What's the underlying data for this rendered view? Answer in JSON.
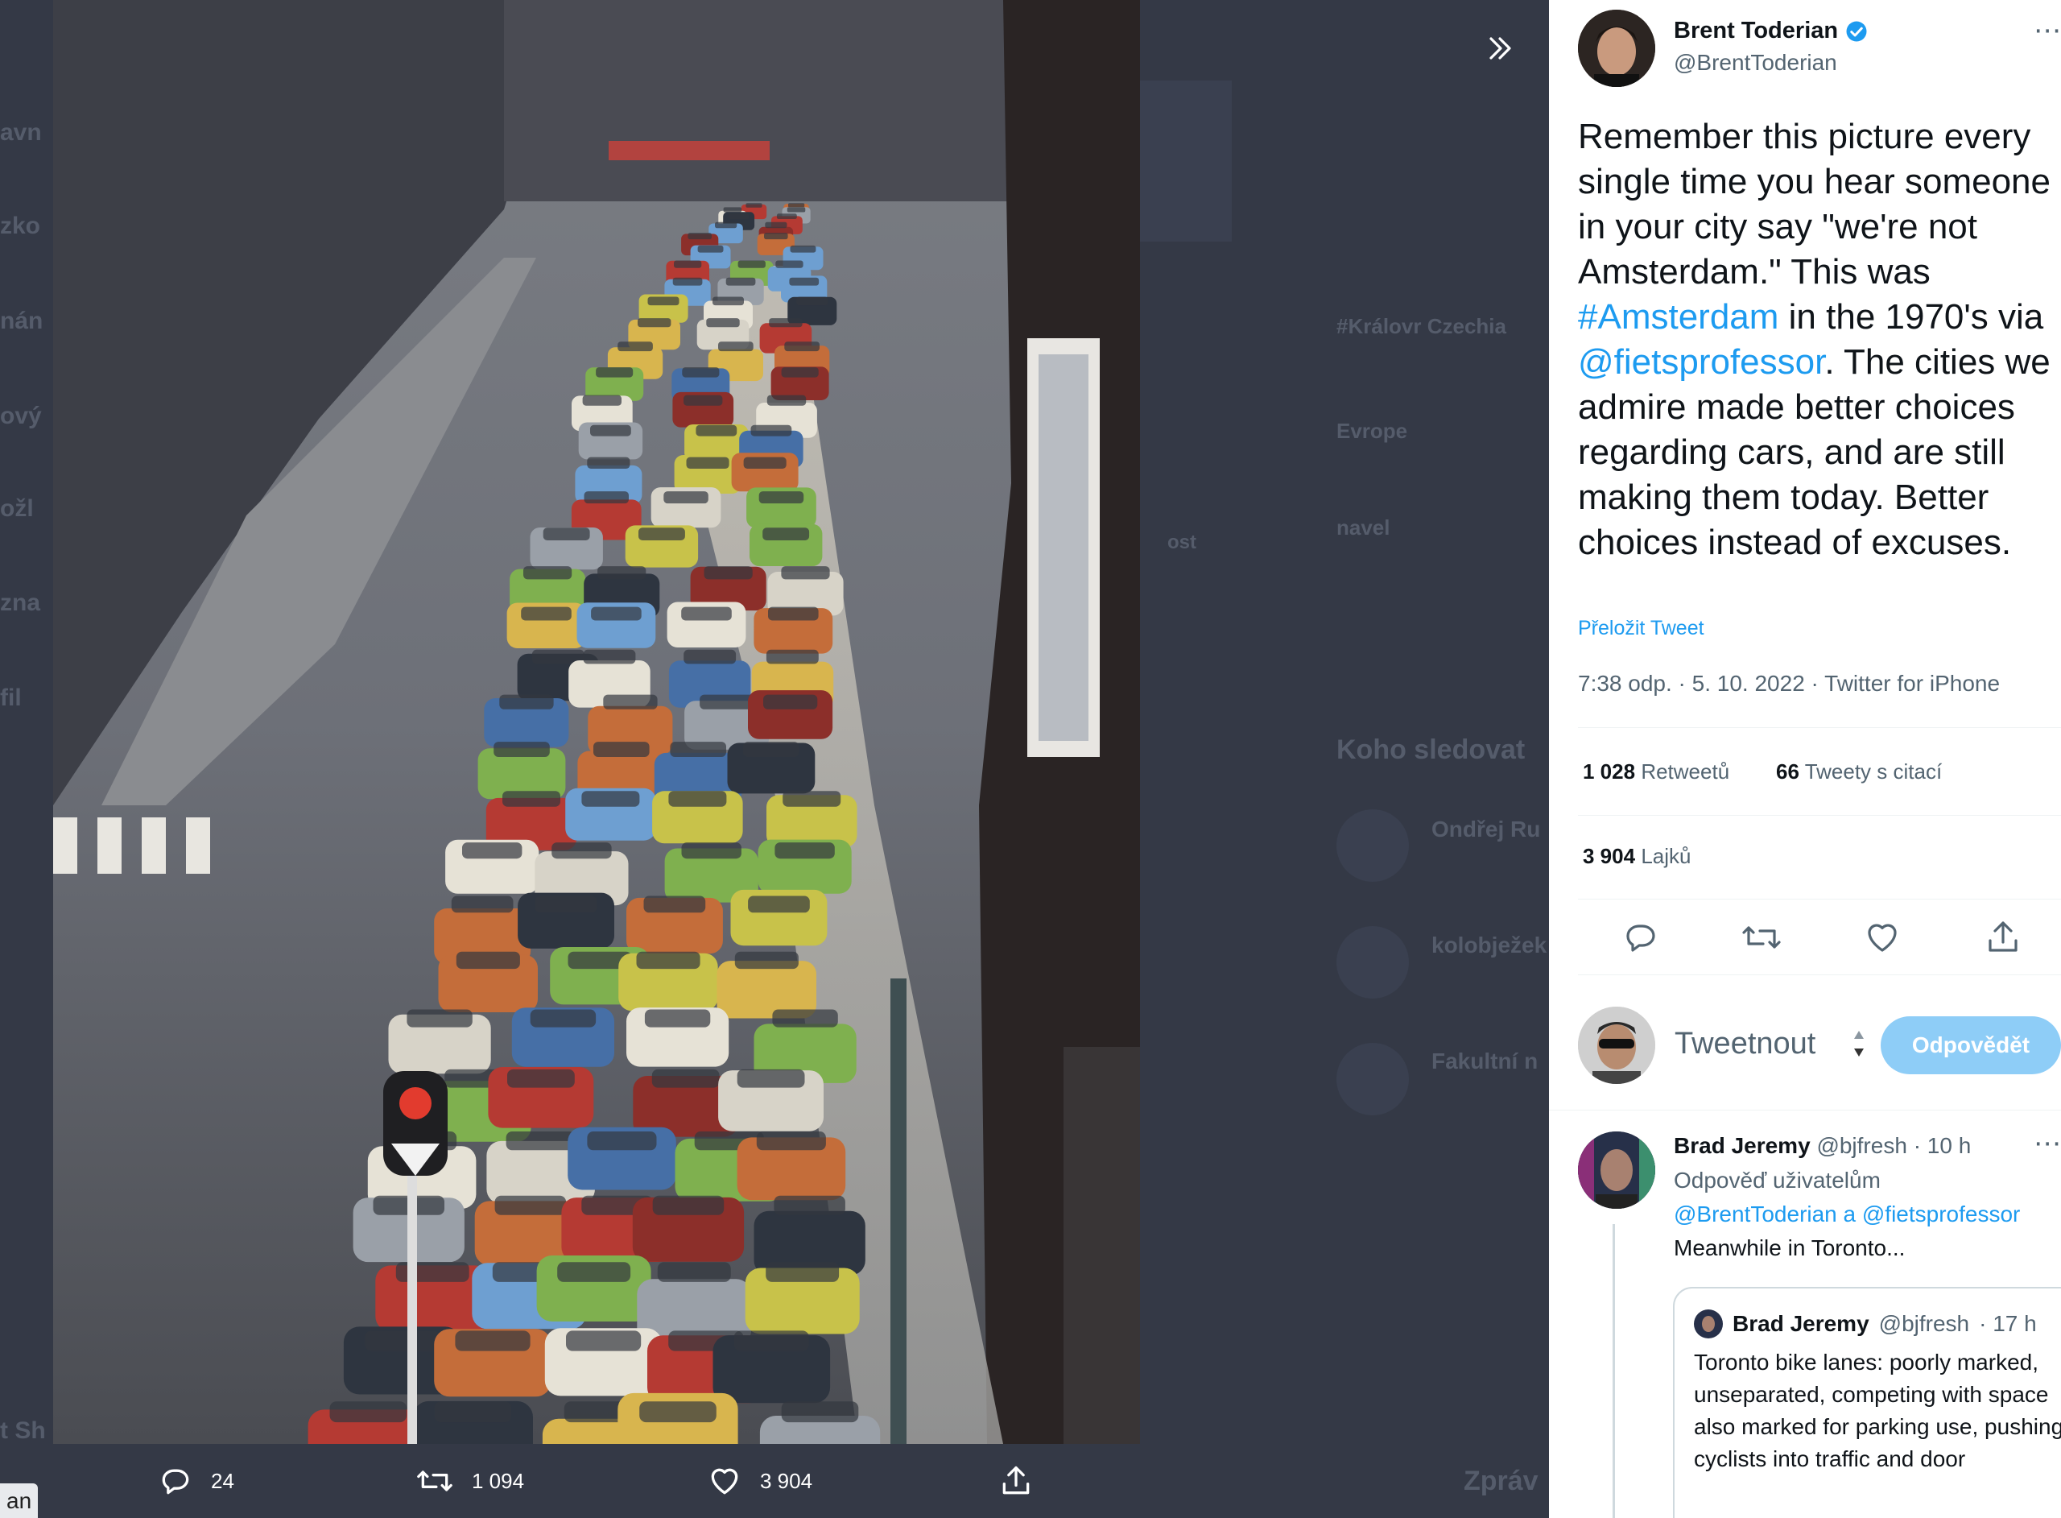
{
  "backdrop": {
    "fragments": [
      "avn",
      "zko",
      "nán",
      "ový",
      "ožl",
      "zna",
      "fil",
      "t Sh",
      "ost",
      "#Královr Czechia",
      "Evrope",
      "navel",
      "Koho sledovat",
      "Ondřej Ru",
      "kolobježek",
      "Fakultní n",
      "Zpráv"
    ],
    "bottom_chip": "an"
  },
  "media_actions": {
    "reply_count": "24",
    "retweet_count": "1 094",
    "like_count": "3 904"
  },
  "tweet": {
    "author_name": "Brent Toderian",
    "author_handle": "@BrentToderian",
    "text_part1": "Remember this picture every single time you hear someone in your city say \"we're not Amsterdam.\" This was ",
    "hashtag": "#Amsterdam",
    "text_part2": " in the 1970's via ",
    "mention": "@fietsprofessor",
    "text_part3": ". The cities we admire made better choices regarding cars, and are still making them today. Better choices instead of excuses.",
    "translate_label": "Přeložit Tweet",
    "timestamp": "7:38 odp. · 5. 10. 2022 · Twitter for iPhone",
    "retweets_count": "1 028",
    "retweets_label": "Retweetů",
    "quotes_count": "66",
    "quotes_label": "Tweety s citací",
    "likes_count": "3 904",
    "likes_label": "Lajků"
  },
  "compose": {
    "placeholder": "Tweetnout",
    "reply_button": "Odpovědět"
  },
  "reply": {
    "author_name": "Brad Jeremy",
    "author_handle": "@bjfresh",
    "age": "· 10 h",
    "replying_to": "Odpověď uživatelům",
    "mentions": "@BrentToderian a @fietsprofessor",
    "text": "Meanwhile in Toronto...",
    "quote": {
      "author_name": "Brad Jeremy",
      "author_handle": "@bjfresh",
      "age": "· 17 h",
      "text": "Toronto bike lanes: poorly marked, unseparated, competing with space also marked for parking use, pushing cyclists into traffic and door"
    }
  },
  "colors": {
    "accent": "#1d9bf0",
    "reply_button_disabled": "#8ecdf7",
    "backdrop": "#343946"
  }
}
